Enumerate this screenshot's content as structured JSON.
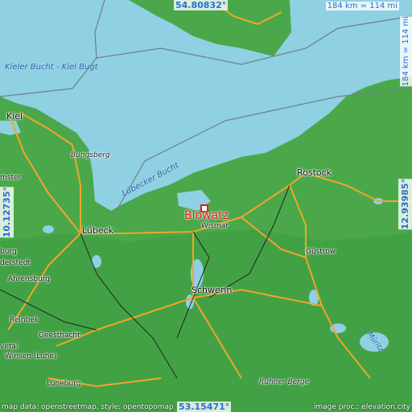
{
  "map": {
    "focus_place": "Blowatz",
    "water_labels": {
      "kiel_bay": "Kieler Bucht - Kiel Bugt",
      "luebeck_bay": "Lübecker Bucht",
      "lake_mueritz": "Müritz"
    },
    "places": [
      {
        "id": "kiel",
        "name": "Kiel"
      },
      {
        "id": "bungsberg",
        "name": "Bungsberg",
        "kind": "peak"
      },
      {
        "id": "rostock",
        "name": "Rostock"
      },
      {
        "id": "luebeck",
        "name": "Lübeck"
      },
      {
        "id": "wismar",
        "name": "Wismar"
      },
      {
        "id": "guestrow",
        "name": "Güstrow"
      },
      {
        "id": "schwerin",
        "name": "Schwerin"
      },
      {
        "id": "ahrensburg",
        "name": "Ahrensburg"
      },
      {
        "id": "reinbek",
        "name": "Reinbek"
      },
      {
        "id": "geesthacht",
        "name": "Geesthacht"
      },
      {
        "id": "winsen",
        "name": "Winsen (Luhe)"
      },
      {
        "id": "lueneburg",
        "name": "Lüneburg"
      },
      {
        "id": "ruhner",
        "name": "Ruhner Berge",
        "kind": "peak"
      },
      {
        "id": "derstedt",
        "name": "derstedt"
      },
      {
        "id": "burg",
        "name": "burg"
      },
      {
        "id": "vetal",
        "name": "vetal"
      },
      {
        "id": "mster",
        "name": "mster"
      }
    ],
    "coordinates": {
      "top": "54.80832°",
      "bottom": "53.15471°",
      "left": "10.12735°",
      "right": "12.93985°"
    },
    "scale": {
      "horizontal": "184 km = 114 mi",
      "vertical": "184 km = 114 mi"
    },
    "attribution_left": "map data: openstreetmap, style: opentopomap",
    "attribution_right": "image proc.: elevation.city"
  }
}
